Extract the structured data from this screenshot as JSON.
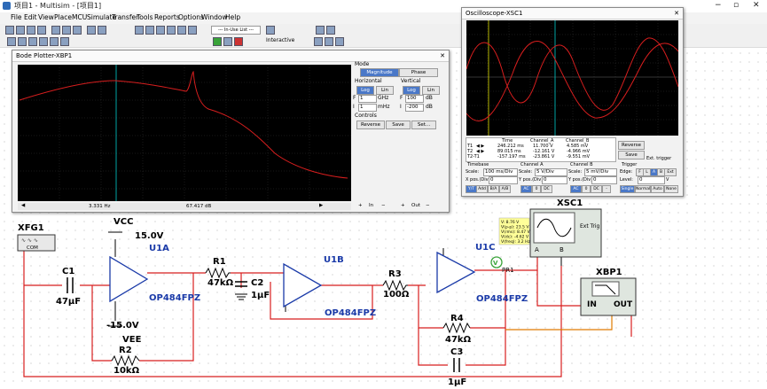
{
  "app": {
    "title": "项目1 - Multisim - [项目1]"
  },
  "menu": [
    "File",
    "Edit",
    "View",
    "Place",
    "MCU",
    "Simulate",
    "Transfer",
    "Tools",
    "Reports",
    "Options",
    "Window",
    "Help"
  ],
  "toolbar": {
    "inuse_list": "--- In-Use List ---",
    "interactive": "Interactive"
  },
  "bode": {
    "title": "Bode Plotter-XBP1",
    "mode_label": "Mode",
    "magnitude": "Magnitude",
    "phase": "Phase",
    "horizontal_label": "Horizontal",
    "vertical_label": "Vertical",
    "log": "Log",
    "lin": "Lin",
    "h_f": "1",
    "h_f_unit": "GHz",
    "h_i": "1",
    "h_i_unit": "mHz",
    "v_f": "100",
    "v_f_unit": "dB",
    "v_i": "-200",
    "v_i_unit": "dB",
    "f_label": "F",
    "i_label": "I",
    "controls_label": "Controls",
    "reverse": "Reverse",
    "save": "Save",
    "set": "Set...",
    "freq_readout": "3.331 Hz",
    "mag_readout": "67.417 dB",
    "in_label": "In",
    "out_label": "Out"
  },
  "scope": {
    "title": "Oscilloscope-XSC1",
    "col_time": "Time",
    "col_a": "Channel_A",
    "col_b": "Channel_B",
    "rows": [
      {
        "name": "T1",
        "time": "246.212 ms",
        "a": "11.700 V",
        "b": "4.585 mV"
      },
      {
        "name": "T2",
        "time": "89.015 ms",
        "a": "-12.161 V",
        "b": "-4.966 mV"
      },
      {
        "name": "T2-T1",
        "time": "-157.197 ms",
        "a": "-23.861 V",
        "b": "-9.551 mV"
      }
    ],
    "reverse": "Reverse",
    "save": "Save",
    "ext_trigger": "Ext. trigger",
    "timebase_label": "Timebase",
    "tb_scale_label": "Scale:",
    "tb_scale": "100 ms/Div",
    "tb_xpos_label": "X pos.(Div):",
    "tb_xpos": "0",
    "tb_modes": [
      "Y/T",
      "Add",
      "B/A",
      "A/B"
    ],
    "cha_label": "Channel A",
    "cha_scale_label": "Scale:",
    "cha_scale": "5 V/Div",
    "cha_ypos_label": "Y pos.(Div):",
    "cha_ypos": "0",
    "cha_modes": [
      "AC",
      "0",
      "DC"
    ],
    "chb_label": "Channel B",
    "chb_scale_label": "Scale:",
    "chb_scale": "5 mV/Div",
    "chb_ypos_label": "Y pos.(Div):",
    "chb_ypos": "0",
    "chb_modes": [
      "AC",
      "0",
      "DC",
      "-"
    ],
    "trigger_label": "Trigger",
    "edge_label": "Edge:",
    "edge_modes": [
      "F",
      "L",
      "A",
      "B",
      "Ext"
    ],
    "level_label": "Level:",
    "level": "0",
    "level_unit": "V",
    "trig_modes": [
      "Single",
      "Normal",
      "Auto",
      "None"
    ]
  },
  "circuit": {
    "xfg1": "XFG1",
    "com": "COM",
    "vcc": "VCC",
    "vcc_val": "15.0V",
    "vee": "VEE",
    "vee_val": "-15.0V",
    "u1a": "U1A",
    "u1b": "U1B",
    "u1c": "U1C",
    "opamp": "OP484FPZ",
    "c1": "C1",
    "c1_val": "47µF",
    "r1": "R1",
    "r1_val": "47kΩ",
    "c2": "C2",
    "c2_val": "1µF",
    "r2": "R2",
    "r2_val": "10kΩ",
    "r3": "R3",
    "r3_val": "100Ω",
    "r4": "R4",
    "r4_val": "47kΩ",
    "c3": "C3",
    "c3_val": "1µF",
    "xsc1": "XSC1",
    "ext_trig": "Ext Trig",
    "xbp1": "XBP1",
    "in": "IN",
    "out": "OUT",
    "pr1": "PR1",
    "probe_text": [
      "V: 8.76 V",
      "V(p-p): 23.5 V",
      "V(rms): 8.47 V",
      "V(dc): -4.62 V",
      "V(freq): 3.2 Hz"
    ],
    "pin_a": "A",
    "pin_b": "B"
  },
  "colors": {
    "wire_red": "#d81e1e",
    "wire_orange": "#e07b00",
    "label_blue": "#1a3aa8",
    "scope_bg": "#000000"
  }
}
